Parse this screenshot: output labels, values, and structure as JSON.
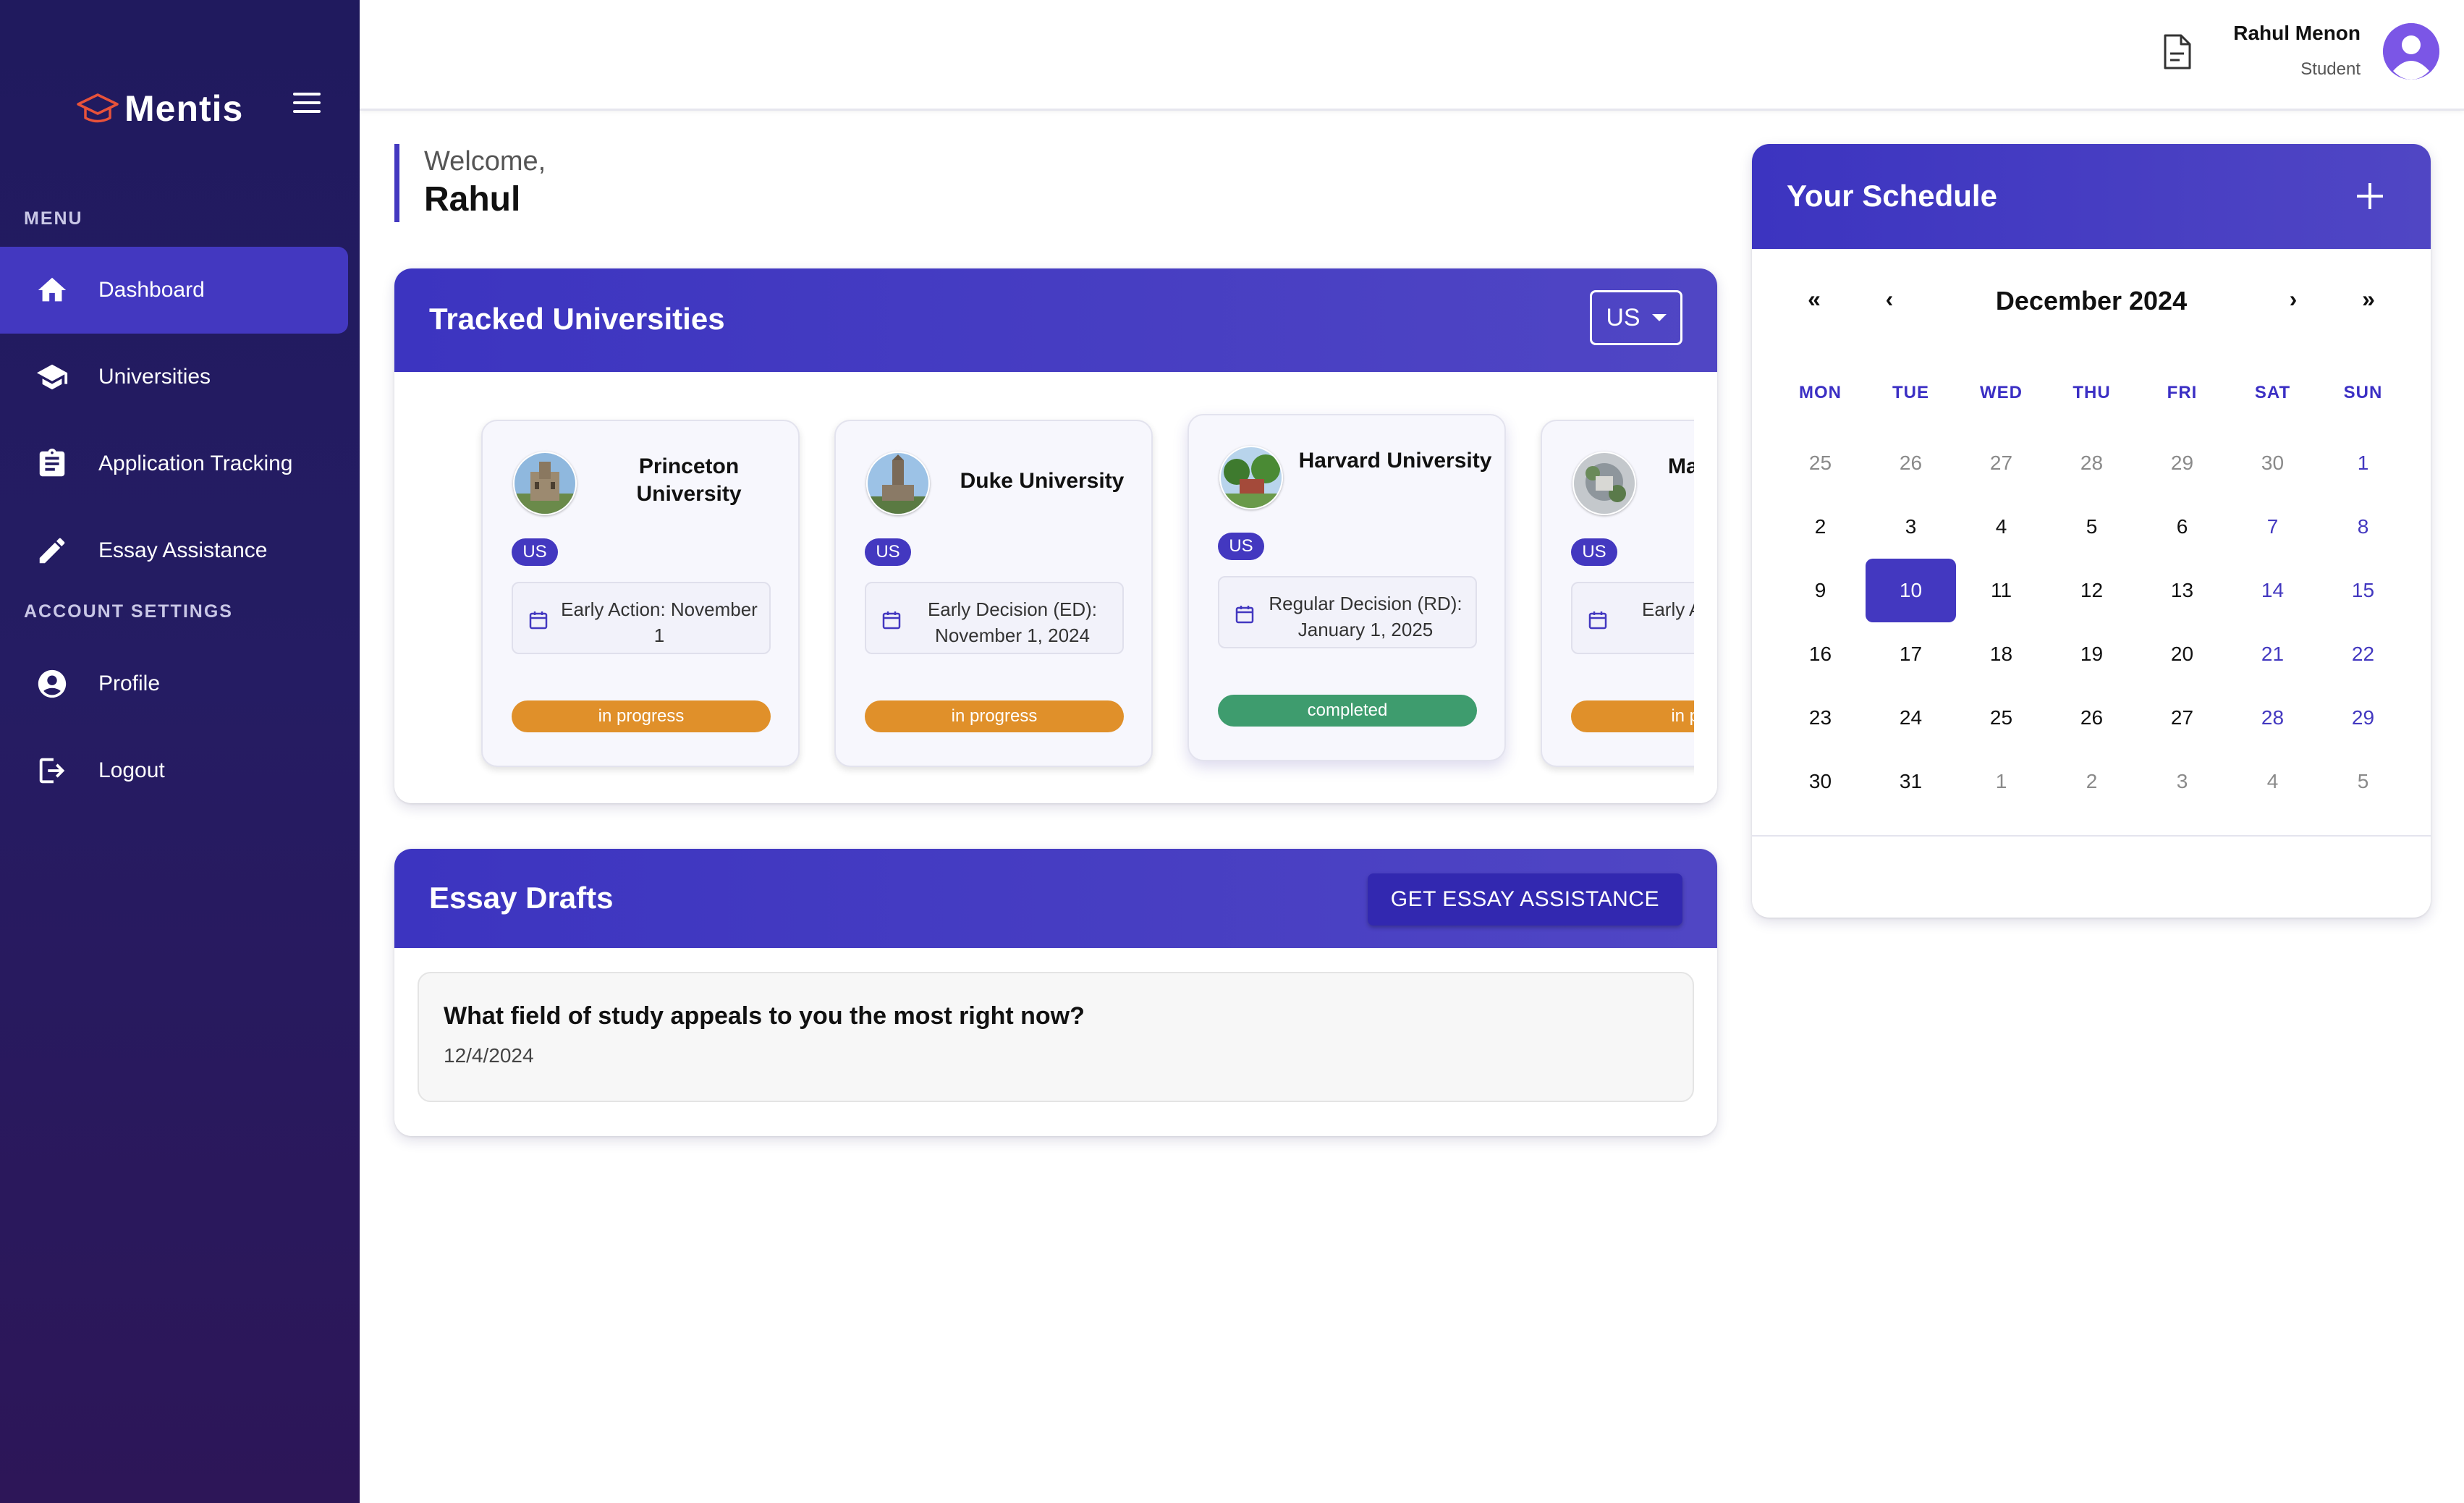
{
  "brand": {
    "name": "Mentis"
  },
  "sidebar": {
    "menu_label": "MENU",
    "account_label": "ACCOUNT SETTINGS",
    "items": [
      {
        "label": "Dashboard",
        "icon": "home-icon",
        "active": true
      },
      {
        "label": "Universities",
        "icon": "graduation-cap-icon"
      },
      {
        "label": "Application Tracking",
        "icon": "clipboard-icon"
      },
      {
        "label": "Essay Assistance",
        "icon": "pencil-icon"
      }
    ],
    "account_items": [
      {
        "label": "Profile",
        "icon": "user-circle-icon"
      },
      {
        "label": "Logout",
        "icon": "logout-icon"
      }
    ]
  },
  "header": {
    "user_name": "Rahul Menon",
    "user_role": "Student"
  },
  "welcome": {
    "greeting": "Welcome,",
    "name": "Rahul"
  },
  "tracked": {
    "title": "Tracked Universities",
    "country_select": "US",
    "universities": [
      {
        "name": "Princeton University",
        "country": "US",
        "deadline": "Early Action: November 1",
        "status": "in progress"
      },
      {
        "name": "Duke University",
        "country": "US",
        "deadline": "Early Decision (ED): November 1, 2024",
        "status": "in progress"
      },
      {
        "name": "Harvard University",
        "country": "US",
        "deadline": "Regular Decision (RD): January 1, 2025",
        "status": "completed"
      },
      {
        "name": "Mass Ins",
        "country": "US",
        "deadline": "Early Act Noven",
        "status": "in progr"
      }
    ]
  },
  "essays": {
    "title": "Essay Drafts",
    "button": "GET ESSAY ASSISTANCE",
    "drafts": [
      {
        "question": "What field of study appeals to you the most right now?",
        "date": "12/4/2024"
      }
    ]
  },
  "schedule": {
    "title": "Your Schedule",
    "month": "December 2024",
    "nav": {
      "prev_year": "«",
      "prev": "‹",
      "next": "›",
      "next_year": "»"
    },
    "weekdays": [
      "MON",
      "TUE",
      "WED",
      "THU",
      "FRI",
      "SAT",
      "SUN"
    ],
    "weeks": [
      [
        "25",
        "26",
        "27",
        "28",
        "29",
        "30",
        "1"
      ],
      [
        "2",
        "3",
        "4",
        "5",
        "6",
        "7",
        "8"
      ],
      [
        "9",
        "10",
        "11",
        "12",
        "13",
        "14",
        "15"
      ],
      [
        "16",
        "17",
        "18",
        "19",
        "20",
        "21",
        "22"
      ],
      [
        "23",
        "24",
        "25",
        "26",
        "27",
        "28",
        "29"
      ],
      [
        "30",
        "31",
        "1",
        "2",
        "3",
        "4",
        "5"
      ]
    ],
    "selected_day": "10"
  },
  "colors": {
    "accent": "#4338c0",
    "sidebar_bg": "#231b60",
    "in_progress": "#e0902a",
    "completed": "#3e9c6e"
  }
}
